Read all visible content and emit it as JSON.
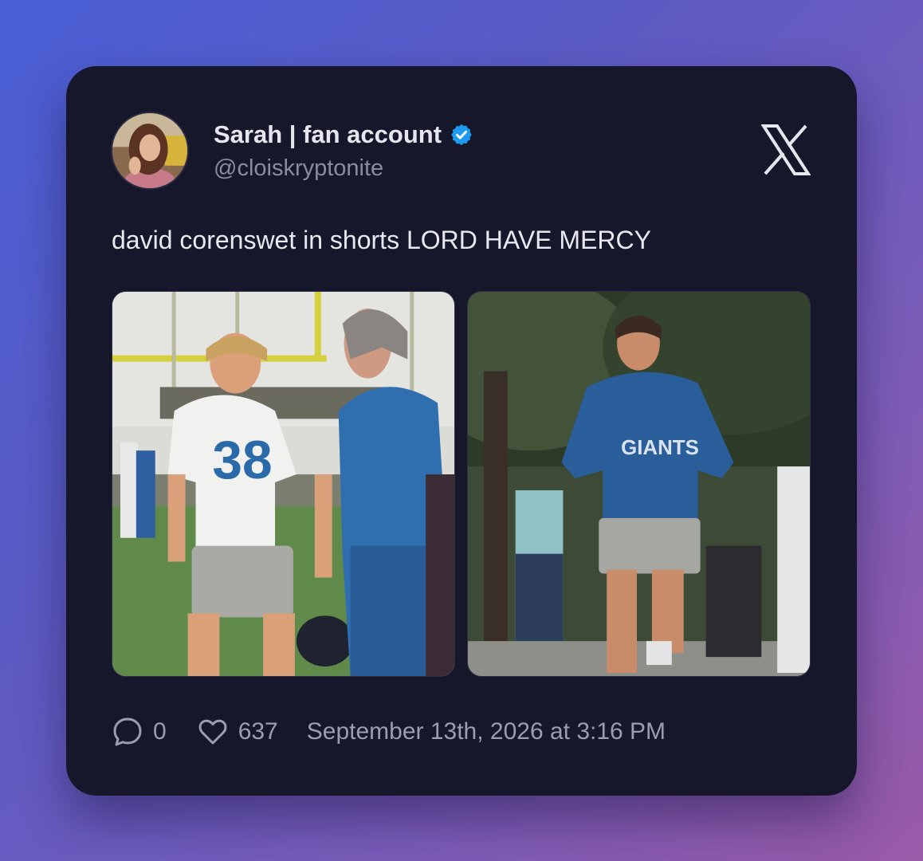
{
  "author": {
    "name": "Sarah | fan account",
    "handle": "@cloiskryptonite",
    "verified": true,
    "avatar_icon": "profile-photo"
  },
  "brand_icon": "x-logo-icon",
  "tweet": {
    "text": "david corenswet in shorts LORD HAVE MERCY",
    "images": [
      {
        "label": "football-player-jersey-38-photo",
        "jersey_number": "38"
      },
      {
        "label": "man-jogging-giants-hoodie-photo",
        "hoodie_text": "GIANTS"
      }
    ]
  },
  "stats": {
    "replies": "0",
    "likes": "637",
    "timestamp": "September 13th, 2026 at 3:16 PM"
  },
  "colors": {
    "card_bg": "#16172a",
    "verified_blue": "#1d9bf0",
    "text_primary": "#e6e6ee",
    "text_secondary": "#8a8ba0"
  }
}
